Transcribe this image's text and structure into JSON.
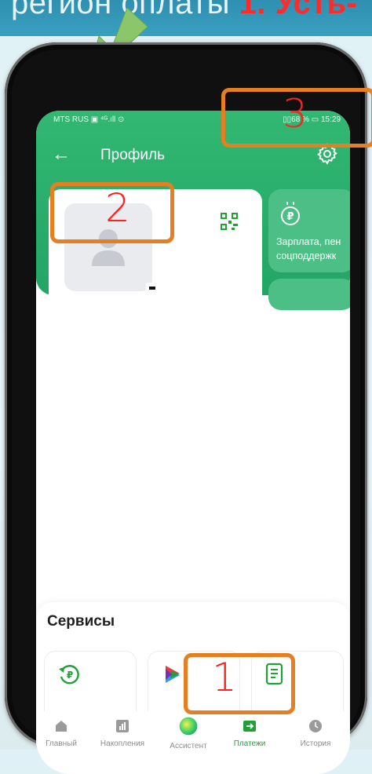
{
  "banner": {
    "text_prefix": "регион оплаты ",
    "text_highlight": "1. Усть-"
  },
  "status_bar": {
    "left": "MTS RUS ▣ ⁴ᴳ.ıll ⊙",
    "right": "▯▯68 % ▭ 15:29"
  },
  "header": {
    "back_icon": "arrow-left-icon",
    "title": "Профиль",
    "settings_icon": "gear-icon"
  },
  "profile": {
    "avatar_icon": "user-avatar-icon",
    "qr_icon": "qr-code-icon"
  },
  "side_card": {
    "icon": "ruble-coin-icon",
    "line1": "Зарплата, пен",
    "line2": "соцподдержк"
  },
  "services": {
    "title": "Сервисы",
    "tiles": [
      {
        "icon": "ruble-refresh-icon",
        "color": "#21a038"
      },
      {
        "icon": "multicolor-logo-icon",
        "color": "#e63946"
      },
      {
        "icon": "document-icon",
        "color": "#21a038"
      }
    ]
  },
  "tabbar": {
    "items": [
      {
        "label": "Главный",
        "icon": "home-icon"
      },
      {
        "label": "Накопления",
        "icon": "chart-icon"
      },
      {
        "label": "Ассистент",
        "icon": "assistant-orb-icon"
      },
      {
        "label": "Платежи",
        "icon": "payments-icon",
        "active": true
      },
      {
        "label": "История",
        "icon": "history-icon"
      }
    ]
  },
  "annotations": {
    "n1": "1",
    "n2": "2",
    "n3": "3",
    "color": "#e67e22",
    "number_color": "#ff2020"
  }
}
